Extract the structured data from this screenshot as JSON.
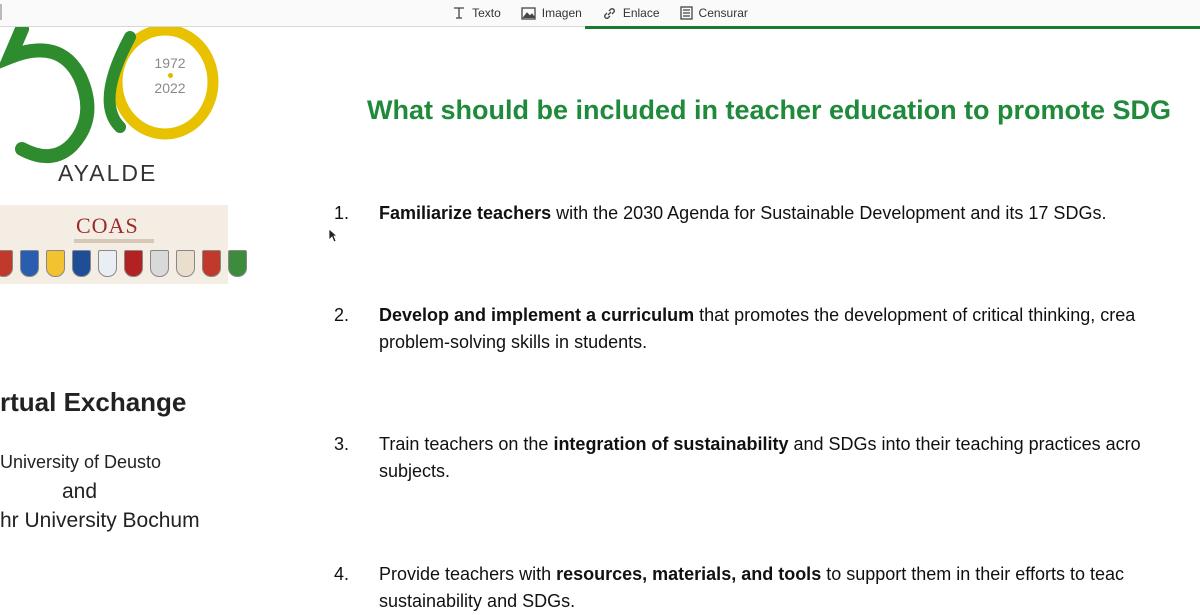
{
  "toolbar": {
    "items": [
      {
        "label": "Texto",
        "icon": "text-cursor-icon"
      },
      {
        "label": "Imagen",
        "icon": "image-icon"
      },
      {
        "label": "Enlace",
        "icon": "link-icon"
      },
      {
        "label": "Censurar",
        "icon": "redact-icon"
      }
    ]
  },
  "colors": {
    "heading_green": "#1e8a3a",
    "logo_green": "#2e8b2e",
    "logo_yellow": "#e8c200",
    "coas_red": "#9b2d2d"
  },
  "logo": {
    "year_start": "1972",
    "year_end": "2022",
    "name": "AYALDE"
  },
  "coas": {
    "label": "COAS"
  },
  "sidebar": {
    "title": "rtual Exchange",
    "partner1": "University of Deusto",
    "conjunction": "and",
    "partner2": "hr University Bochum"
  },
  "slide": {
    "heading": "What should be included in  teacher education to promote  SDG",
    "items": [
      {
        "num": "1.",
        "bold": "Familiarize teachers",
        "rest": " with the 2030 Agenda for Sustainable Development and its 17 SDGs."
      },
      {
        "num": "2.",
        "bold": "Develop and implement a curriculum",
        "rest": " that promotes the development of critical thinking, crea",
        "line2": "problem-solving skills in students."
      },
      {
        "num": "3.",
        "pre": "Train teachers on the ",
        "bold": "integration of sustainability",
        "rest": " and SDGs into their teaching practices acro",
        "line2": "subjects."
      },
      {
        "num": "4.",
        "pre": "Provide teachers with ",
        "bold": "resources, materials, and tools",
        "rest": " to support them in their efforts to teac",
        "line2": "sustainability and SDGs."
      }
    ]
  }
}
